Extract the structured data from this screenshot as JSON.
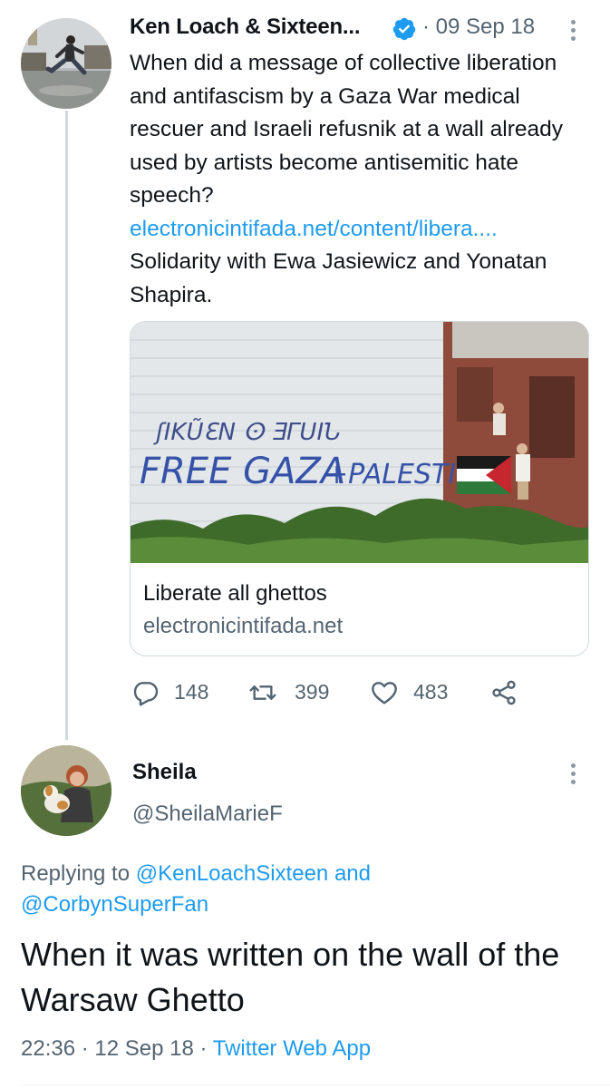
{
  "tweet": {
    "author_name": "Ken Loach & Sixteen...",
    "date": "09 Sep 18",
    "date_separator": "·",
    "text_before_link": "When did a message of collective liberation and antifascism by a Gaza War medical rescuer and Israeli refusnik at a wall already used by artists become antisemitic hate speech?",
    "link": "electronicintifada.net/content/libera....",
    "text_after_link": "Solidarity with Ewa Jasiewicz and Yonatan Shapira.",
    "card": {
      "title": "Liberate all ghettos",
      "domain": "electronicintifada.net",
      "image_text": "FREE GAZA"
    },
    "actions": {
      "reply_count": "148",
      "retweet_count": "399",
      "like_count": "483"
    }
  },
  "reply": {
    "author_name": "Sheila",
    "handle": "@SheilaMarieF",
    "replying_prefix": "Replying to",
    "mention_1": "@KenLoachSixteen",
    "and_word": "and",
    "mention_2": "@CorbynSuperFan",
    "text": "When it was written on the wall of the Warsaw Ghetto",
    "time": "22:36",
    "separator": "·",
    "date": "12 Sep 18",
    "app": "Twitter Web App"
  },
  "colors": {
    "link_blue": "#1d9bf0",
    "secondary_text": "#536471",
    "thread_line": "#cfd9de",
    "verified_blue": "#1d9bf0"
  },
  "icons": [
    "verified-badge-icon",
    "more-options-icon",
    "reply-icon",
    "retweet-icon",
    "like-icon",
    "share-icon"
  ]
}
